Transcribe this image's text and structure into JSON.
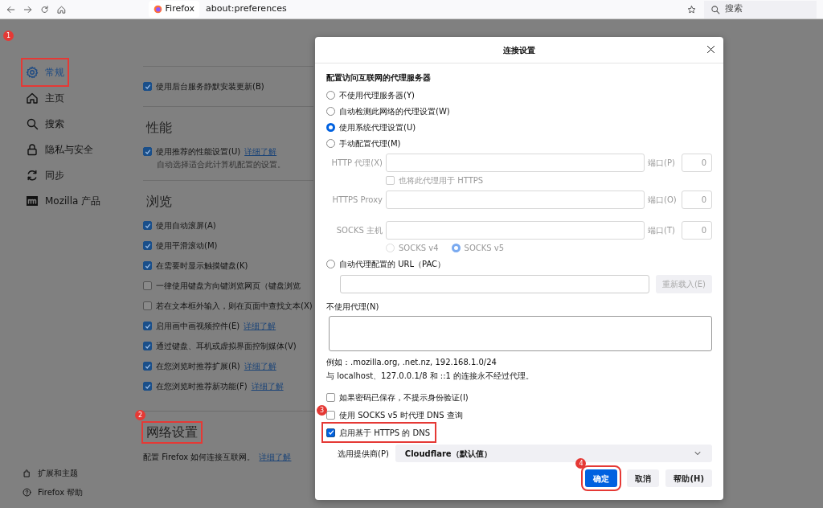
{
  "toolbar": {
    "site_label": "Firefox",
    "url": "about:preferences",
    "search_placeholder": "搜索"
  },
  "sidebar": {
    "items": [
      {
        "label": "常规",
        "selected": true,
        "annotation": "1"
      },
      {
        "label": "主页",
        "selected": false
      },
      {
        "label": "搜索",
        "selected": false
      },
      {
        "label": "隐私与安全",
        "selected": false
      },
      {
        "label": "同步",
        "selected": false
      },
      {
        "label": "Mozilla 产品",
        "selected": false
      }
    ],
    "footer": [
      {
        "label": "扩展和主题"
      },
      {
        "label": "Firefox 帮助"
      }
    ]
  },
  "sections": [
    {
      "items": [
        {
          "label": "使用后台服务静默安装更新(B)",
          "checked": true
        }
      ]
    },
    {
      "title": "性能",
      "items": [
        {
          "label": "使用推荐的性能设置(U)",
          "checked": true,
          "link": "详细了解",
          "note": "自动选择适合此计算机配置的设置。"
        }
      ]
    },
    {
      "title": "浏览",
      "items": [
        {
          "label": "使用自动滚屏(A)",
          "checked": true
        },
        {
          "label": "使用平滑滚动(M)",
          "checked": true
        },
        {
          "label": "在需要时显示触摸键盘(K)",
          "checked": true
        },
        {
          "label": "一律使用键盘方向键浏览网页（键盘浏览",
          "checked": false
        },
        {
          "label": "若在文本框外输入，则在页面中查找文本(X)",
          "checked": false
        },
        {
          "label": "启用画中画视频控件(E)",
          "checked": true,
          "link": "详细了解"
        },
        {
          "label": "通过键盘、耳机或虚拟界面控制媒体(V)",
          "checked": true
        },
        {
          "label": "在您浏览时推荐扩展(R)",
          "checked": true,
          "link": "详细了解"
        },
        {
          "label": "在您浏览时推荐新功能(F)",
          "checked": true,
          "link": "详细了解"
        }
      ]
    },
    {
      "title": "网络设置",
      "annotation": "2",
      "description": "配置 Firefox 如何连接互联网。",
      "link": "详细了解"
    }
  ],
  "dialog": {
    "title": "连接设置",
    "heading": "配置访问互联网的代理服务器",
    "modes": [
      {
        "label": "不使用代理服务器(Y)",
        "selected": false
      },
      {
        "label": "自动检测此网络的代理设置(W)",
        "selected": false
      },
      {
        "label": "使用系统代理设置(U)",
        "selected": true
      },
      {
        "label": "手动配置代理(M)",
        "selected": false
      }
    ],
    "proxies": [
      {
        "label": "HTTP 代理(X)",
        "port_label": "端口(P)",
        "port": "0",
        "also_https": {
          "label": "也将此代理用于 HTTPS",
          "checked": false
        }
      },
      {
        "label": "HTTPS Proxy",
        "port_label": "端口(O)",
        "port": "0"
      },
      {
        "label": "SOCKS 主机",
        "port_label": "端口(T)",
        "port": "0"
      }
    ],
    "socks_versions": [
      {
        "label": "SOCKS v4",
        "selected": false
      },
      {
        "label": "SOCKS v5",
        "selected": true
      }
    ],
    "pac": {
      "label": "自动代理配置的 URL（PAC）",
      "selected": false,
      "reload": "重新载入(E)"
    },
    "no_proxy": {
      "label": "不使用代理(N)",
      "hints": [
        "例如：.mozilla.org, .net.nz, 192.168.1.0/24",
        "与 localhost、127.0.0.1/8 和 ::1 的连接永不经过代理。"
      ]
    },
    "options": [
      {
        "label": "如果密码已保存，不提示身份验证(I)",
        "checked": false
      },
      {
        "label": "使用 SOCKS v5 时代理 DNS 查询",
        "checked": false,
        "annotation": "3"
      },
      {
        "label": "启用基于 HTTPS 的 DNS",
        "checked": true,
        "highlighted": true
      }
    ],
    "provider": {
      "label": "选用提供商(P)",
      "value": "Cloudflare（默认值）"
    },
    "buttons": [
      {
        "label": "确定",
        "kind": "primary",
        "annotation": "4"
      },
      {
        "label": "取消",
        "kind": "secondary"
      },
      {
        "label": "帮助(H)",
        "kind": "secondary"
      }
    ]
  }
}
